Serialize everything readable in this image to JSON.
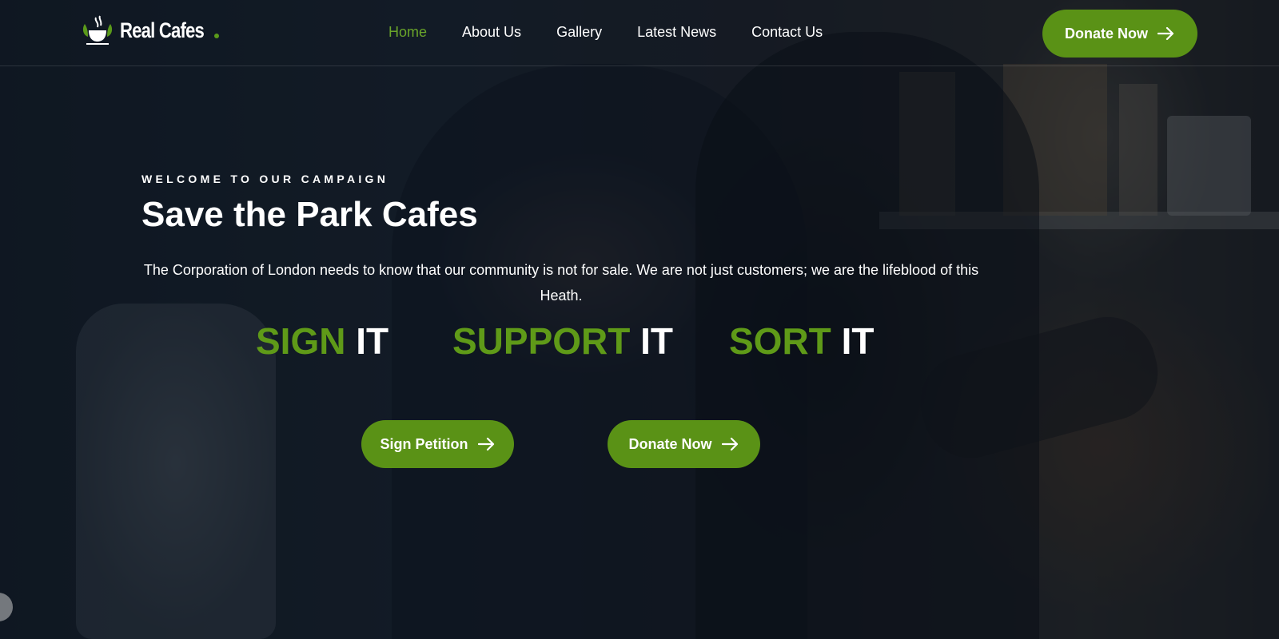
{
  "logo": {
    "text": "Real Cafes",
    "icon": "coffee-cup-leaves-icon"
  },
  "nav": {
    "items": [
      {
        "label": "Home",
        "active": true
      },
      {
        "label": "About Us"
      },
      {
        "label": "Gallery"
      },
      {
        "label": "Latest News"
      },
      {
        "label": "Contact Us"
      }
    ]
  },
  "header": {
    "donate_label": "Donate Now"
  },
  "hero": {
    "eyebrow": "WELCOME TO OUR CAMPAIGN",
    "title": "Save the Park Cafes",
    "text": "The Corporation of London needs to know that our community is not for sale. We are not just customers; we are the lifeblood of this Heath.",
    "slogans": [
      {
        "word": "SIGN",
        "suffix": "IT"
      },
      {
        "word": "SUPPORT",
        "suffix": "IT"
      },
      {
        "word": "SORT",
        "suffix": "IT"
      }
    ],
    "sign_label": "Sign Petition",
    "donate_label": "Donate Now"
  },
  "colors": {
    "accent": "#5a9216",
    "active_nav": "#6aa52a",
    "overlay": "#070e18"
  },
  "icons": {
    "button_arrow": "arrow-right-icon"
  }
}
